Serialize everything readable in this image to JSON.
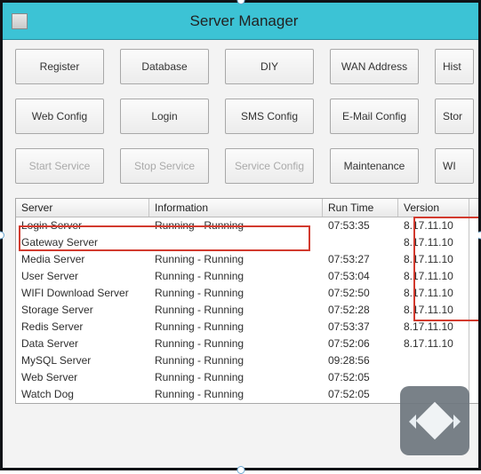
{
  "window": {
    "title": "Server Manager"
  },
  "toolbar": {
    "rows": [
      [
        {
          "label": "Register",
          "enabled": true
        },
        {
          "label": "Database",
          "enabled": true
        },
        {
          "label": "DIY",
          "enabled": true
        },
        {
          "label": "WAN Address",
          "enabled": true
        },
        {
          "label": "Hist",
          "enabled": true,
          "cut": true
        }
      ],
      [
        {
          "label": "Web Config",
          "enabled": true
        },
        {
          "label": "Login",
          "enabled": true
        },
        {
          "label": "SMS Config",
          "enabled": true
        },
        {
          "label": "E-Mail Config",
          "enabled": true
        },
        {
          "label": "Stor",
          "enabled": true,
          "cut": true
        }
      ],
      [
        {
          "label": "Start Service",
          "enabled": false
        },
        {
          "label": "Stop Service",
          "enabled": false
        },
        {
          "label": "Service Config",
          "enabled": false
        },
        {
          "label": "Maintenance",
          "enabled": true
        },
        {
          "label": "WI",
          "enabled": true,
          "cut": true
        }
      ]
    ]
  },
  "table": {
    "headers": {
      "server": "Server",
      "info": "Information",
      "time": "Run Time",
      "ver": "Version"
    },
    "rows": [
      {
        "server": "Login Server",
        "info": "Running - Running",
        "time": "07:53:35",
        "ver": "8.17.11.10"
      },
      {
        "server": "Gateway Server",
        "info": "",
        "time": "",
        "ver": "8.17.11.10"
      },
      {
        "server": "Media Server",
        "info": "Running - Running",
        "time": "07:53:27",
        "ver": "8.17.11.10"
      },
      {
        "server": "User Server",
        "info": "Running - Running",
        "time": "07:53:04",
        "ver": "8.17.11.10"
      },
      {
        "server": "WIFI Download Server",
        "info": "Running - Running",
        "time": "07:52:50",
        "ver": "8.17.11.10"
      },
      {
        "server": "Storage Server",
        "info": "Running - Running",
        "time": "07:52:28",
        "ver": "8.17.11.10"
      },
      {
        "server": "Redis Server",
        "info": "Running - Running",
        "time": "07:53:37",
        "ver": "8.17.11.10"
      },
      {
        "server": "Data Server",
        "info": "Running - Running",
        "time": "07:52:06",
        "ver": "8.17.11.10"
      },
      {
        "server": "MySQL Server",
        "info": "Running - Running",
        "time": "09:28:56",
        "ver": ""
      },
      {
        "server": "Web Server",
        "info": "Running - Running",
        "time": "07:52:05",
        "ver": ""
      },
      {
        "server": "Watch Dog",
        "info": "Running - Running",
        "time": "07:52:05",
        "ver": ""
      }
    ]
  }
}
